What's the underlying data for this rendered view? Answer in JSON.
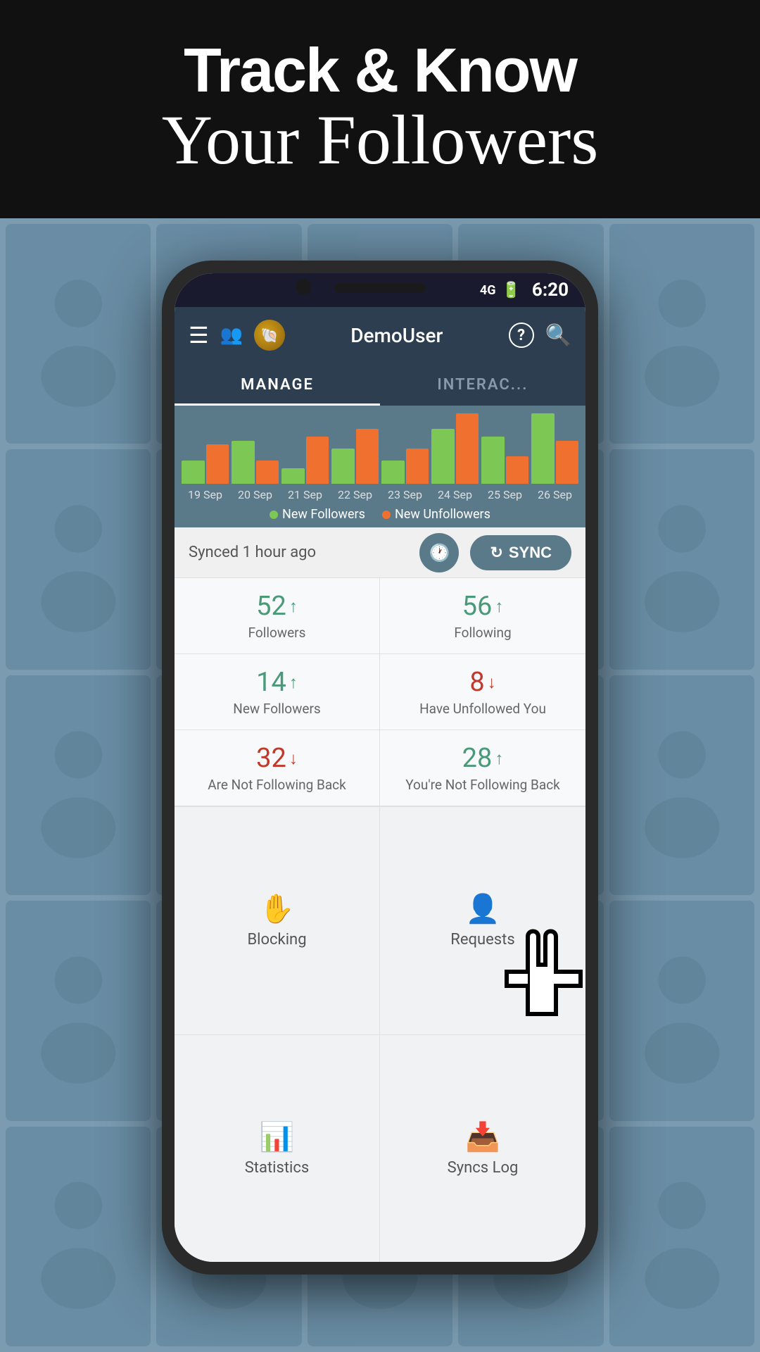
{
  "hero": {
    "line1": "Track & Know",
    "line2": "Your Followers"
  },
  "status_bar": {
    "signal": "4G",
    "battery": "🔋",
    "time": "6:20"
  },
  "header": {
    "username": "DemoUser",
    "menu_icon": "☰",
    "users_icon": "👥",
    "help_icon": "?",
    "search_icon": "🔍"
  },
  "tabs": [
    {
      "label": "MANAGE",
      "active": true
    },
    {
      "label": "INTERAC...",
      "active": false
    }
  ],
  "chart": {
    "dates": [
      "19 Sep",
      "20 Sep",
      "21 Sep",
      "22 Sep",
      "23 Sep",
      "24 Sep",
      "25 Sep",
      "26 Sep"
    ],
    "green_bars": [
      30,
      55,
      20,
      45,
      30,
      70,
      60,
      90
    ],
    "orange_bars": [
      50,
      30,
      60,
      70,
      45,
      90,
      35,
      55
    ],
    "legend": {
      "new_followers_label": "New Followers",
      "new_unfollowers_label": "New Unfollowers"
    }
  },
  "sync": {
    "text": "Synced  1 hour ago",
    "button_label": "SYNC"
  },
  "stats": [
    {
      "number": "52",
      "arrow": "up",
      "label": "Followers"
    },
    {
      "number": "56",
      "arrow": "up",
      "label": "Following"
    },
    {
      "number": "14",
      "arrow": "up",
      "label": "New Followers"
    },
    {
      "number": "8",
      "arrow": "down",
      "label": "Have Unfollowed You"
    },
    {
      "number": "32",
      "arrow": "down",
      "label": "Are Not Following Back"
    },
    {
      "number": "28",
      "arrow": "up",
      "label": "You're Not Following Back"
    }
  ],
  "bottom_items": [
    {
      "icon": "✋",
      "label": "Blocking"
    },
    {
      "icon": "👤?",
      "label": "Requests"
    },
    {
      "icon": "📊",
      "label": "Statistics"
    },
    {
      "icon": "📥",
      "label": "Syncs Log"
    }
  ]
}
